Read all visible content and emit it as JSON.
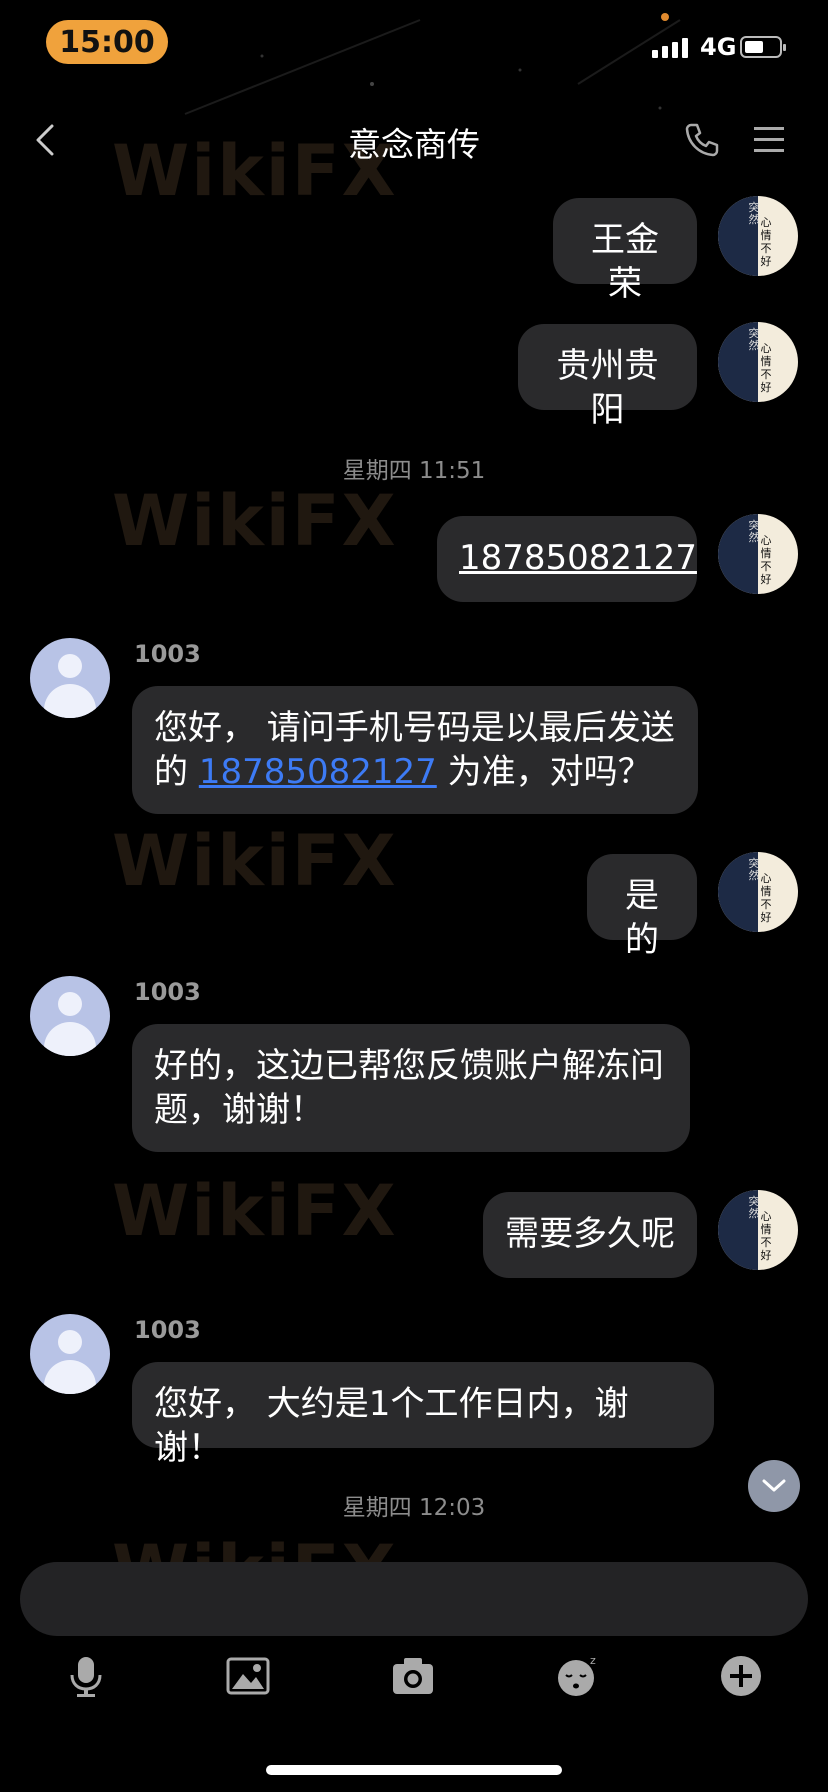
{
  "status_bar": {
    "time": "15:00",
    "network": "4G"
  },
  "nav": {
    "title": "意念商传"
  },
  "watermark": "WikiFX",
  "avatar_self_text": {
    "left": "突然",
    "right": "心情不好"
  },
  "messages": [
    {
      "type": "out",
      "text": "王金荣"
    },
    {
      "type": "out",
      "text": "贵州贵阳"
    },
    {
      "type": "time",
      "text": "星期四 11:51"
    },
    {
      "type": "out",
      "text": "18785082127"
    },
    {
      "type": "in",
      "sender": "1003",
      "line1": "您好， 请问手机号码是以最后发送",
      "line2_pre": "的 ",
      "line2_link": "18785082127",
      "line2_post": " 为准，对吗？"
    },
    {
      "type": "out",
      "text": "是的"
    },
    {
      "type": "in",
      "sender": "1003",
      "text": "好的，这边已帮您反馈账户解冻问题，谢谢！"
    },
    {
      "type": "out",
      "text": "需要多久呢"
    },
    {
      "type": "in",
      "sender": "1003",
      "text": "您好， 大约是1个工作日内，谢谢！"
    },
    {
      "type": "time",
      "text": "星期四 12:03"
    }
  ],
  "toolbar": [
    "microphone-icon",
    "image-icon",
    "camera-icon",
    "sticker-icon",
    "plus-icon"
  ],
  "colors": {
    "accent": "#f0a23c",
    "link": "#3d7bf5",
    "bubble": "#2a2a2c",
    "background": "#000000"
  }
}
